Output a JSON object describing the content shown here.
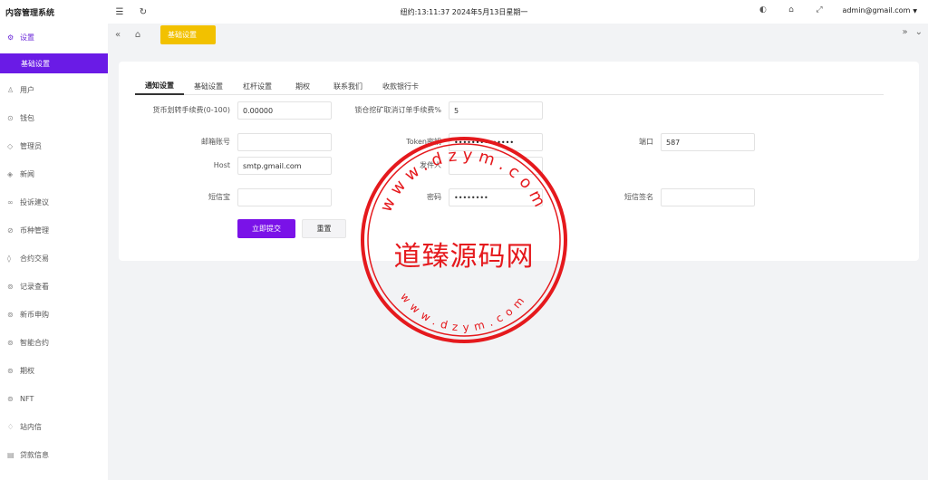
{
  "app": {
    "title": "内容管理系统"
  },
  "header": {
    "clock": "纽约:13:11:37 2024年5月13日星期一",
    "user": "admin@gmail.com"
  },
  "sidebar": {
    "items": [
      {
        "label": "设置",
        "icon": "gear-icon"
      },
      {
        "label": "基础设置",
        "icon": ""
      },
      {
        "label": "用户",
        "icon": "user-icon"
      },
      {
        "label": "钱包",
        "icon": "wallet-icon"
      },
      {
        "label": "管理员",
        "icon": "shield-icon"
      },
      {
        "label": "新闻",
        "icon": "tag-icon"
      },
      {
        "label": "投诉建议",
        "icon": "link-icon"
      },
      {
        "label": "币种管理",
        "icon": "coin-icon"
      },
      {
        "label": "合约交易",
        "icon": "diamond-icon"
      },
      {
        "label": "记录查看",
        "icon": "record-icon"
      },
      {
        "label": "新币申购",
        "icon": "new-coin-icon"
      },
      {
        "label": "智能合约",
        "icon": "contract-icon"
      },
      {
        "label": "期权",
        "icon": "option-icon"
      },
      {
        "label": "NFT",
        "icon": "nft-icon"
      },
      {
        "label": "站内信",
        "icon": "bell-icon"
      },
      {
        "label": "贷款信息",
        "icon": "loan-icon"
      }
    ]
  },
  "tabstrip": {
    "current": "基础设置"
  },
  "tabs": [
    "通知设置",
    "基础设置",
    "杠杆设置",
    "期权",
    "联系我们",
    "收款银行卡"
  ],
  "form": {
    "fee_label": "货币划转手续费(0-100)",
    "fee_value": "0.00000",
    "cancel_fee_label": "锁仓挖矿取消订单手续费%",
    "cancel_fee_value": "5",
    "email_label": "邮箱账号",
    "email_value": "",
    "token_label": "Token密钥",
    "token_value": "••••••••••••••",
    "port_label": "端口",
    "port_value": "587",
    "host_label": "Host",
    "host_value": "smtp.gmail.com",
    "sender_label": "发件人",
    "sender_value": "",
    "sms_label": "短信宝",
    "sms_value": "",
    "password_label": "密码",
    "password_value": "••••••••",
    "sms_sign_label": "短信签名",
    "sms_sign_value": "",
    "submit": "立即提交",
    "reset": "重置"
  },
  "watermark": {
    "main": "道臻源码网",
    "url_top": "www.dzym.com",
    "url_bottom": "www.dzym.com"
  },
  "colors": {
    "primary": "#7a12e8",
    "tab_active": "#f2c100",
    "stamp": "#e5191d"
  }
}
